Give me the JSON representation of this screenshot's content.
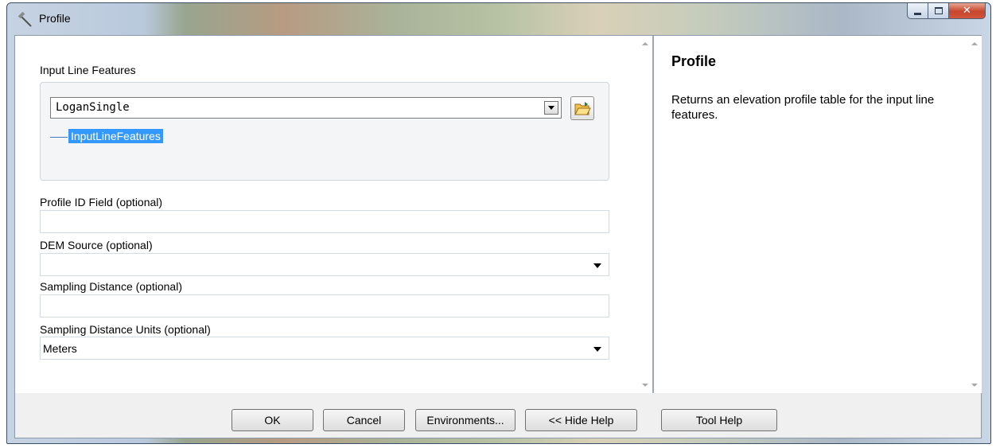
{
  "window": {
    "title": "Profile",
    "title_icon": "hammer-icon",
    "caption_buttons": [
      "minimize-icon",
      "maximize-icon",
      "close-icon"
    ]
  },
  "params": {
    "input_line_features": {
      "label": "Input Line Features",
      "value": "LoganSingle",
      "tree_item": "InputLineFeatures",
      "browse_icon": "folder-open-icon"
    },
    "profile_id_field": {
      "label": "Profile ID Field (optional)",
      "value": ""
    },
    "dem_source": {
      "label": "DEM Source (optional)",
      "value": ""
    },
    "sampling_distance": {
      "label": "Sampling Distance (optional)",
      "value": ""
    },
    "sampling_distance_units": {
      "label": "Sampling Distance Units (optional)",
      "value": "Meters"
    }
  },
  "help": {
    "title": "Profile",
    "text": "Returns an elevation profile table for the input line features."
  },
  "buttons": {
    "ok": "OK",
    "cancel": "Cancel",
    "environments": "Environments...",
    "hide_help": "<< Hide Help",
    "tool_help": "Tool Help"
  }
}
